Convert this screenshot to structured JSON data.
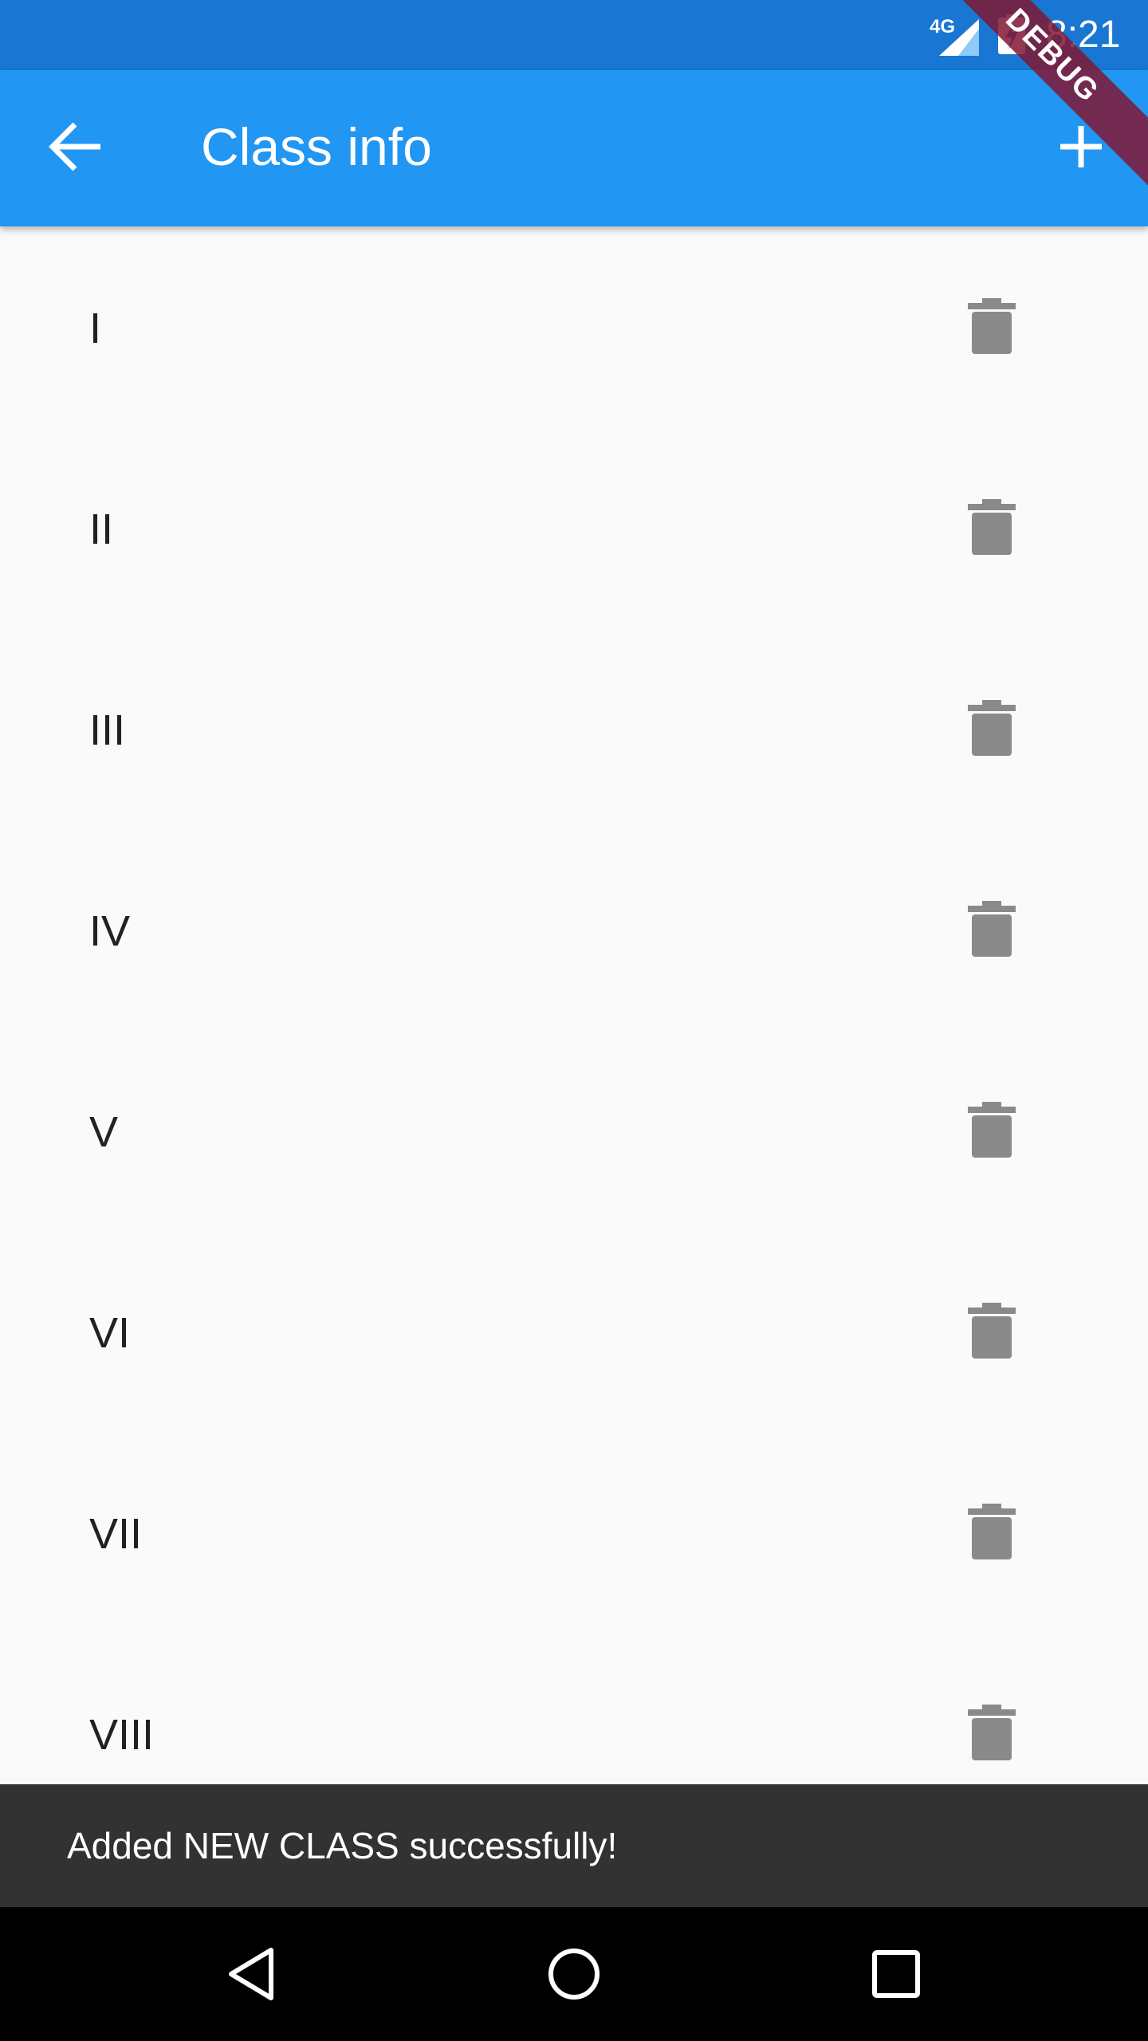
{
  "status_bar": {
    "network": "4G",
    "time": "8:21"
  },
  "app_bar": {
    "title": "Class info",
    "back_icon": "arrow-back-icon",
    "add_icon": "plus-icon",
    "color": "#2196f3"
  },
  "debug_banner": "DEBUG",
  "classes": [
    {
      "label": "I"
    },
    {
      "label": "II"
    },
    {
      "label": "III"
    },
    {
      "label": "IV"
    },
    {
      "label": "V"
    },
    {
      "label": "VI"
    },
    {
      "label": "VII"
    },
    {
      "label": "VIII"
    }
  ],
  "snackbar": {
    "message": "Added NEW CLASS successfully!"
  },
  "nav_bar": {
    "icons": [
      "back-triangle-icon",
      "home-circle-icon",
      "recents-square-icon"
    ]
  }
}
